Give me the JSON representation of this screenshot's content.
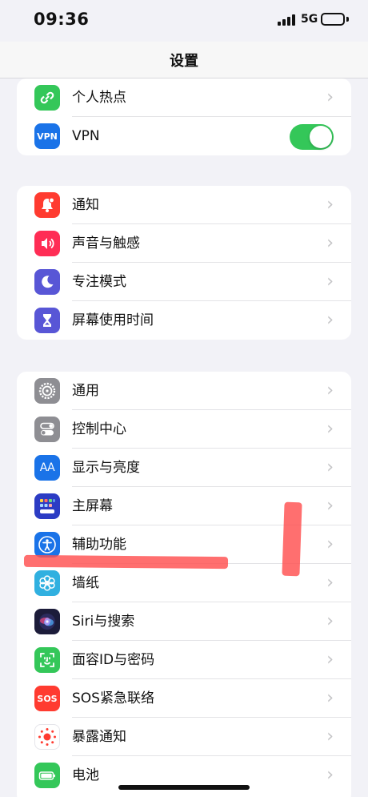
{
  "status_bar": {
    "time": "09:36",
    "network": "5G"
  },
  "nav": {
    "title": "设置"
  },
  "group1": [
    {
      "label": "个人热点",
      "icon": "hotspot-icon",
      "color": "#34c759"
    },
    {
      "label": "VPN",
      "icon": "vpn-icon",
      "color": "#1a73e8",
      "toggle_on": true
    }
  ],
  "group2": [
    {
      "label": "通知",
      "icon": "bell-icon",
      "color": "#ff3b30"
    },
    {
      "label": "声音与触感",
      "icon": "speaker-icon",
      "color": "#ff2d55"
    },
    {
      "label": "专注模式",
      "icon": "moon-icon",
      "color": "#5856d6"
    },
    {
      "label": "屏幕使用时间",
      "icon": "hourglass-icon",
      "color": "#5856d6"
    }
  ],
  "group3": [
    {
      "label": "通用",
      "icon": "gear-icon",
      "color": "#8e8e93"
    },
    {
      "label": "控制中心",
      "icon": "switches-icon",
      "color": "#8e8e93"
    },
    {
      "label": "显示与亮度",
      "icon": "text-size-icon",
      "color": "#1a73e8"
    },
    {
      "label": "主屏幕",
      "icon": "home-grid-icon",
      "color": "#2c3cc4"
    },
    {
      "label": "辅助功能",
      "icon": "accessibility-icon",
      "color": "#1a73e8"
    },
    {
      "label": "墙纸",
      "icon": "flower-icon",
      "color": "#30b0e0"
    },
    {
      "label": "Siri与搜索",
      "icon": "siri-icon",
      "color": "#1c1c3a"
    },
    {
      "label": "面容ID与密码",
      "icon": "face-id-icon",
      "color": "#34c759"
    },
    {
      "label": "SOS紧急联络",
      "icon": "sos-icon",
      "color": "#ff3b30"
    },
    {
      "label": "暴露通知",
      "icon": "exposure-icon",
      "color": "#ffffff"
    },
    {
      "label": "电池",
      "icon": "battery-icon",
      "color": "#34c759"
    }
  ],
  "icon_text": {
    "vpn": "VPN",
    "display": "AA",
    "sos": "SOS"
  },
  "annotation_color": "#ff4f4f"
}
